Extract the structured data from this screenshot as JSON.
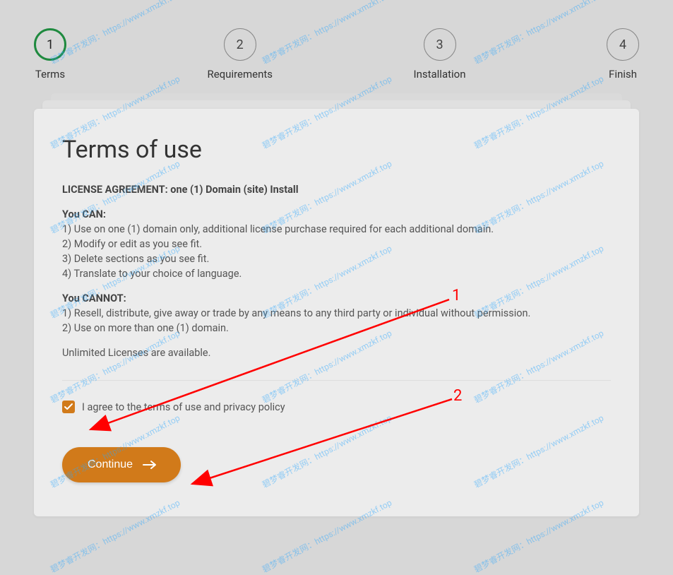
{
  "stepper": {
    "steps": [
      {
        "num": "1",
        "label": "Terms",
        "active": true
      },
      {
        "num": "2",
        "label": "Requirements",
        "active": false
      },
      {
        "num": "3",
        "label": "Installation",
        "active": false
      },
      {
        "num": "4",
        "label": "Finish",
        "active": false
      }
    ]
  },
  "card": {
    "title": "Terms of use",
    "license_heading": "LICENSE AGREEMENT: one (1) Domain (site) Install",
    "can_label": "You CAN:",
    "can_items": [
      "1) Use on one (1) domain only, additional license purchase required for each additional domain.",
      "2) Modify or edit as you see fit.",
      "3) Delete sections as you see fit.",
      "4) Translate to your choice of language."
    ],
    "cannot_label": "You CANNOT:",
    "cannot_items": [
      "1) Resell, distribute, give away or trade by any means to any third party or individual without permission.",
      "2) Use on more than one (1) domain."
    ],
    "footer_line": "Unlimited Licenses are available.",
    "agree_label": "I agree to the terms of use and privacy policy",
    "agree_checked": true,
    "continue_label": "Continue"
  },
  "annotations": {
    "num1": "1",
    "num2": "2"
  },
  "watermark_text": "碧梦睿开发网：https://www.xmzkf.top"
}
